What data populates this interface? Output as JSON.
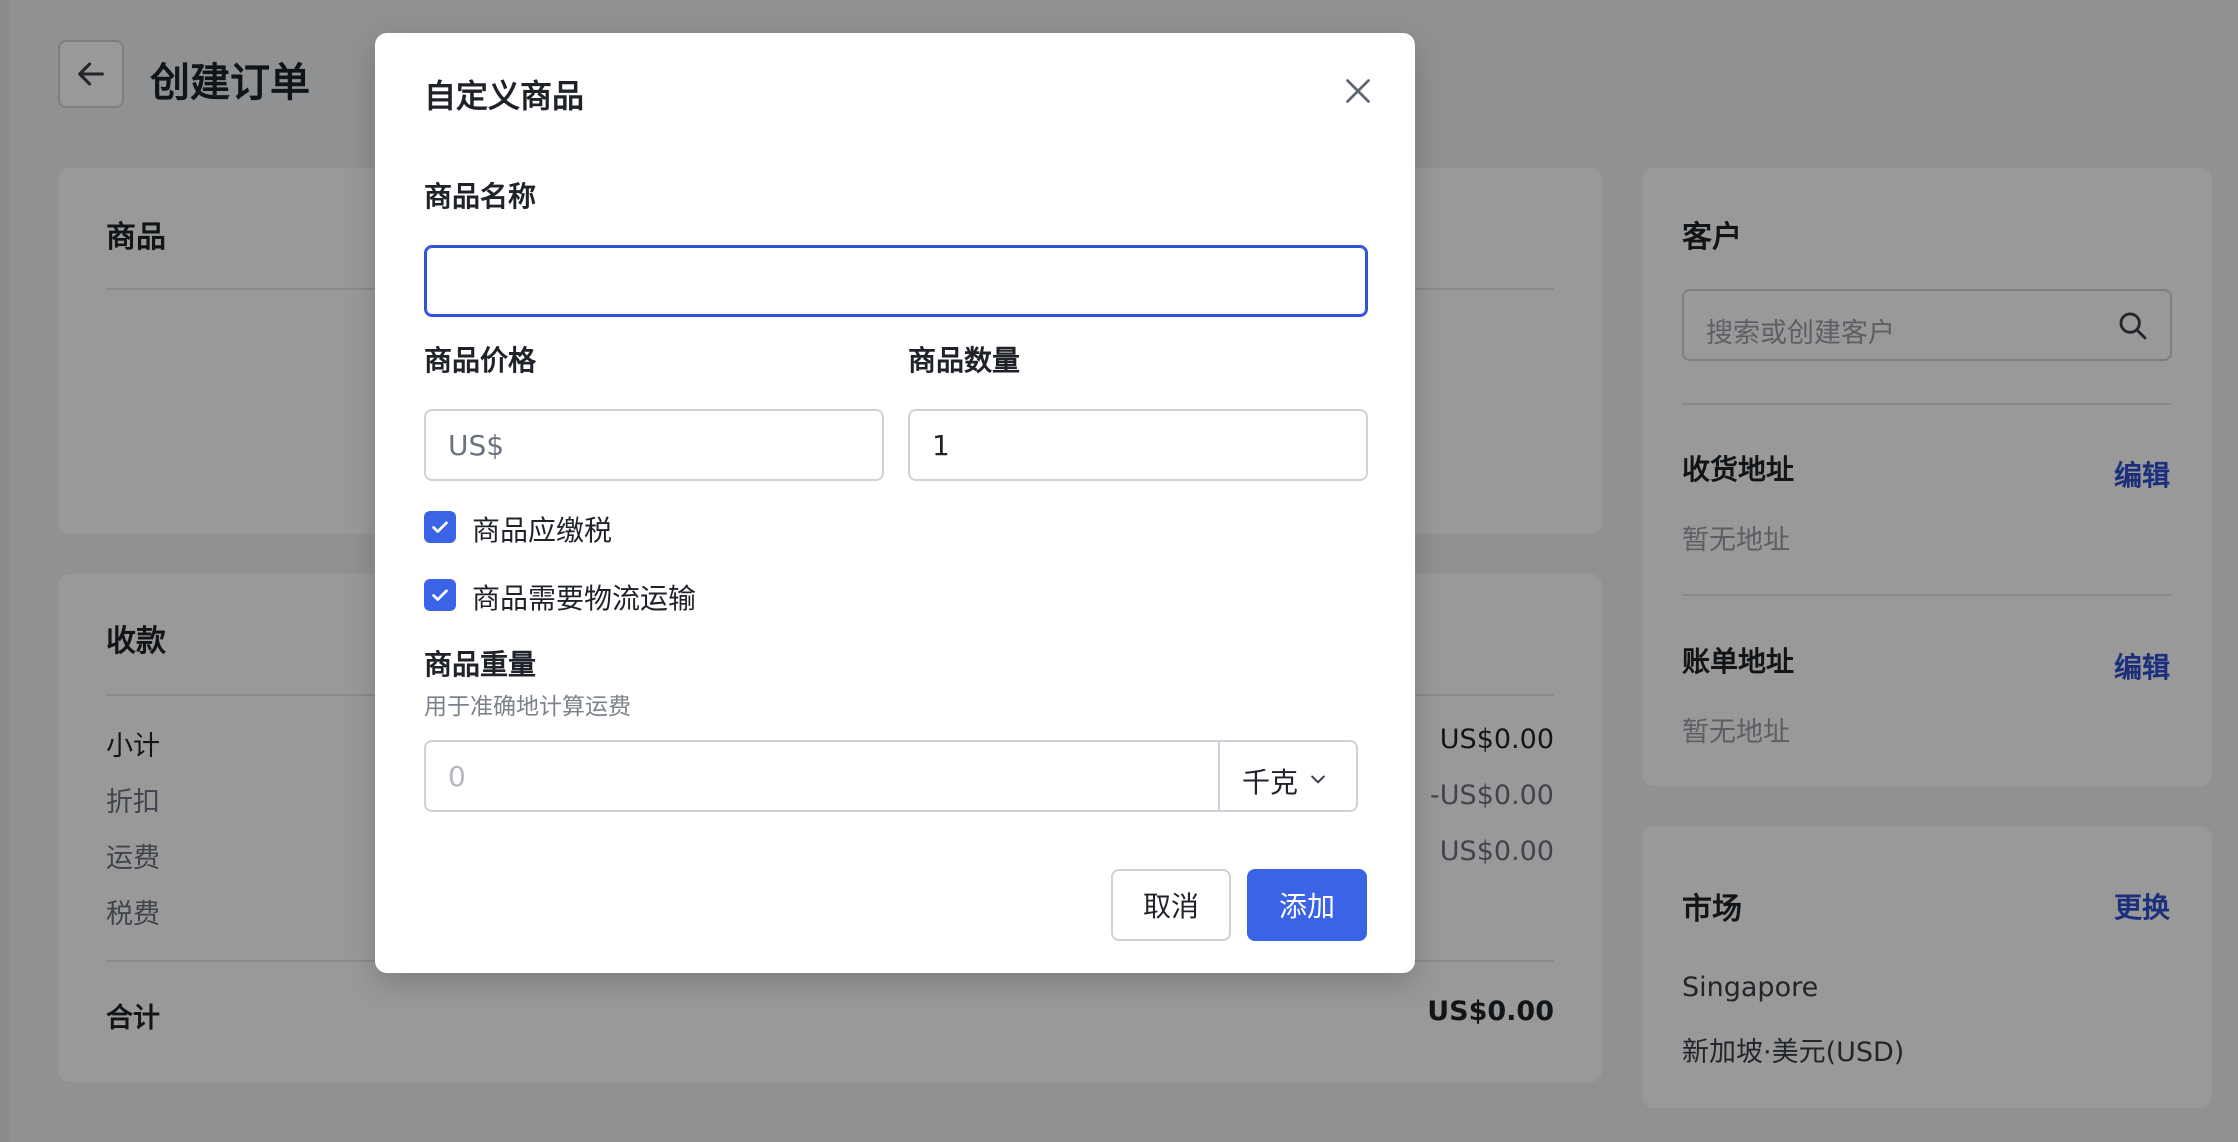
{
  "header": {
    "title": "创建订单"
  },
  "products_card": {
    "title": "商品"
  },
  "payment_card": {
    "title": "收款",
    "rows": [
      {
        "label": "小计",
        "value": "US$0.00"
      },
      {
        "label": "折扣",
        "value": "-US$0.00"
      },
      {
        "label": "运费",
        "value": "US$0.00"
      },
      {
        "label": "税费",
        "value": ""
      }
    ],
    "total_label": "合计",
    "total_value": "US$0.00"
  },
  "customer_card": {
    "title": "客户",
    "search_placeholder": "搜索或创建客户",
    "shipping_title": "收货地址",
    "shipping_edit": "编辑",
    "shipping_empty": "暂无地址",
    "billing_title": "账单地址",
    "billing_edit": "编辑",
    "billing_empty": "暂无地址"
  },
  "market_card": {
    "title": "市场",
    "change": "更换",
    "market_name": "Singapore",
    "market_currency": "新加坡·美元(USD)"
  },
  "modal": {
    "title": "自定义商品",
    "name_label": "商品名称",
    "name_value": "",
    "price_label": "商品价格",
    "price_placeholder": "US$",
    "qty_label": "商品数量",
    "qty_value": "1",
    "taxable_label": "商品应缴税",
    "taxable_checked": true,
    "shipping_label": "商品需要物流运输",
    "shipping_checked": true,
    "weight_label": "商品重量",
    "weight_hint": "用于准确地计算运费",
    "weight_placeholder": "0",
    "weight_unit": "千克",
    "cancel": "取消",
    "add": "添加"
  },
  "colors": {
    "accent": "#3b63e6",
    "link": "#2f4fd1",
    "overlay": "rgba(0,0,0,0.40)"
  }
}
